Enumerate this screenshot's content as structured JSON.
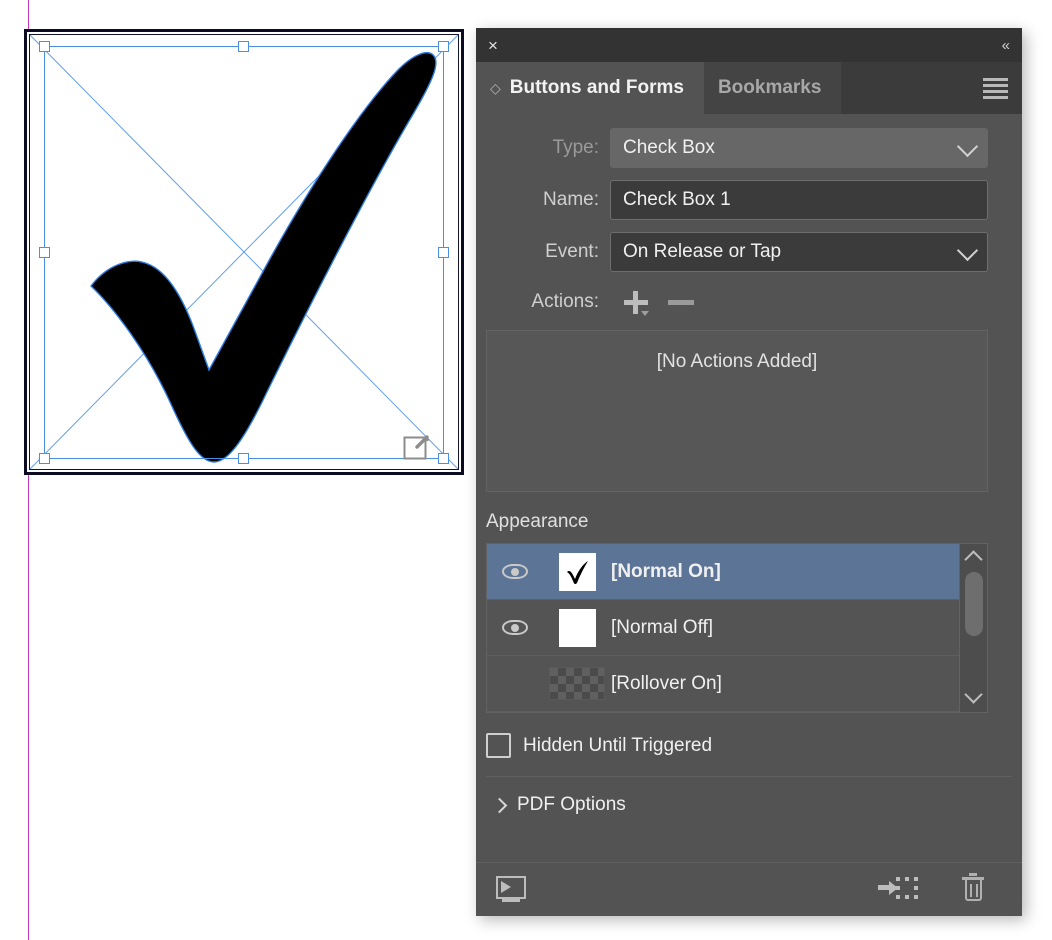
{
  "canvas": {
    "artwork_name": "checkmark-artwork",
    "guide_color": "#c238c2",
    "selection_color": "#4a90e2",
    "form_field_badge": "form-field-badge"
  },
  "panel": {
    "close_label": "×",
    "collapse_label": "«",
    "tabs": [
      {
        "label": "Buttons and Forms",
        "active": true
      },
      {
        "label": "Bookmarks",
        "active": false
      }
    ],
    "menu_label": "panel-menu",
    "accent_selected": "#5c7496",
    "background": "#535353"
  },
  "form": {
    "type": {
      "label": "Type:",
      "value": "Check Box"
    },
    "name": {
      "label": "Name:",
      "value": "Check Box 1",
      "placeholder": "Check Box 1"
    },
    "event": {
      "label": "Event:",
      "value": "On Release or Tap"
    },
    "actions": {
      "label": "Actions:",
      "add_label": "+",
      "remove_label": "−",
      "empty_text": "[No Actions Added]"
    }
  },
  "appearance": {
    "title": "Appearance",
    "states": [
      {
        "name": "[Normal On]",
        "visible": true,
        "thumb": "check",
        "selected": true
      },
      {
        "name": "[Normal Off]",
        "visible": true,
        "thumb": "blank",
        "selected": false
      },
      {
        "name": "[Rollover On]",
        "visible": false,
        "thumb": "transparent",
        "selected": false
      }
    ]
  },
  "options": {
    "hidden_until_triggered": {
      "label": "Hidden Until Triggered",
      "checked": false
    },
    "pdf_options": {
      "label": "PDF Options",
      "expanded": false
    }
  },
  "footer": {
    "preview_label": "preview-spread-icon",
    "convert_label": "convert-to-button-icon",
    "delete_label": "delete-icon"
  }
}
